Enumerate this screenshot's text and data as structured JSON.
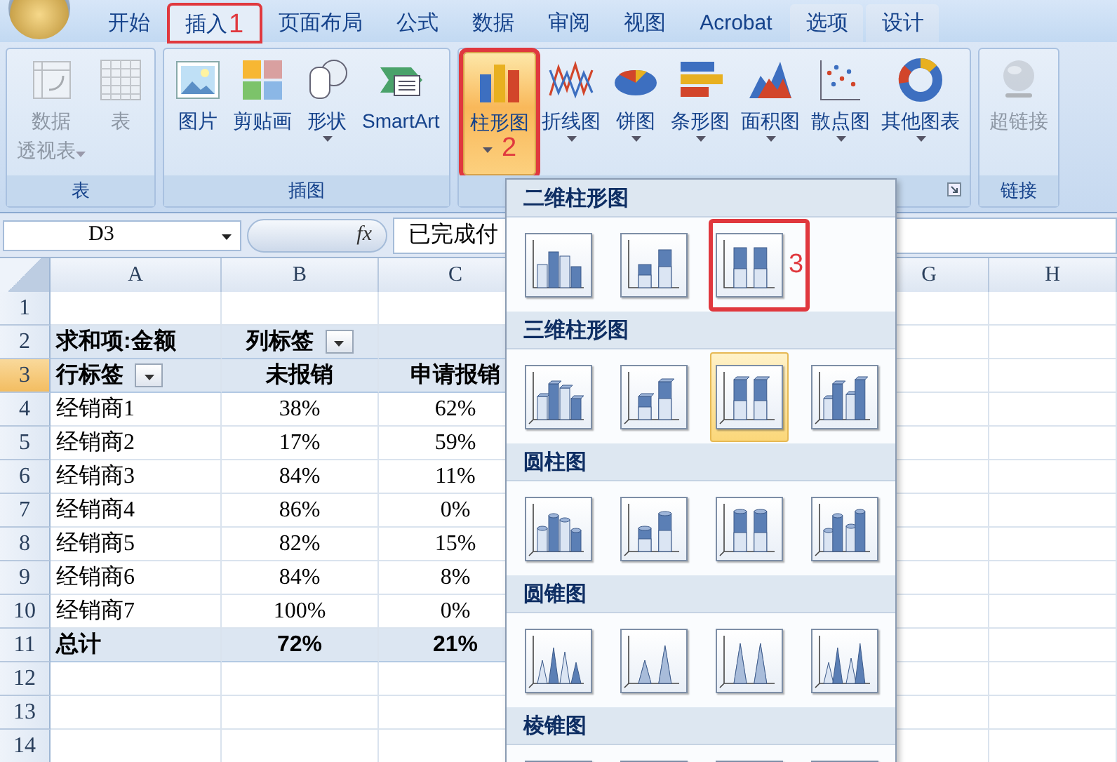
{
  "tabs": [
    {
      "label": "开始",
      "selected": false,
      "contextual": false
    },
    {
      "label": "插入",
      "selected": true,
      "contextual": false,
      "annotation": "1"
    },
    {
      "label": "页面布局",
      "selected": false,
      "contextual": false
    },
    {
      "label": "公式",
      "selected": false,
      "contextual": false
    },
    {
      "label": "数据",
      "selected": false,
      "contextual": false
    },
    {
      "label": "审阅",
      "selected": false,
      "contextual": false
    },
    {
      "label": "视图",
      "selected": false,
      "contextual": false
    },
    {
      "label": "Acrobat",
      "selected": false,
      "contextual": false
    },
    {
      "label": "选项",
      "selected": false,
      "contextual": true
    },
    {
      "label": "设计",
      "selected": false,
      "contextual": true
    }
  ],
  "ribbon_groups": [
    {
      "label": "表",
      "buttons": [
        {
          "lines": [
            "数据",
            "透视表"
          ],
          "disabled": true,
          "dropdown": true,
          "selected": false
        },
        {
          "lines": [
            "表"
          ],
          "disabled": true,
          "dropdown": false,
          "selected": false
        }
      ]
    },
    {
      "label": "插图",
      "buttons": [
        {
          "lines": [
            "图片"
          ],
          "disabled": false,
          "dropdown": false,
          "selected": false
        },
        {
          "lines": [
            "剪贴画"
          ],
          "disabled": false,
          "dropdown": false,
          "selected": false
        },
        {
          "lines": [
            "形状"
          ],
          "disabled": false,
          "dropdown": true,
          "selected": false
        },
        {
          "lines": [
            "SmartArt"
          ],
          "disabled": false,
          "dropdown": false,
          "selected": false
        }
      ]
    },
    {
      "launcher": true,
      "buttons": [
        {
          "lines": [
            "柱形图"
          ],
          "disabled": false,
          "dropdown": true,
          "selected": true,
          "annotation": "2"
        },
        {
          "lines": [
            "折线图"
          ],
          "disabled": false,
          "dropdown": true,
          "selected": false
        },
        {
          "lines": [
            "饼图"
          ],
          "disabled": false,
          "dropdown": true,
          "selected": false
        },
        {
          "lines": [
            "条形图"
          ],
          "disabled": false,
          "dropdown": true,
          "selected": false
        },
        {
          "lines": [
            "面积图"
          ],
          "disabled": false,
          "dropdown": true,
          "selected": false
        },
        {
          "lines": [
            "散点图"
          ],
          "disabled": false,
          "dropdown": true,
          "selected": false
        },
        {
          "lines": [
            "其他图表"
          ],
          "disabled": false,
          "dropdown": true,
          "selected": false
        }
      ]
    },
    {
      "label": "链接",
      "buttons": [
        {
          "lines": [
            "超链接"
          ],
          "disabled": true,
          "dropdown": false,
          "selected": false
        }
      ]
    }
  ],
  "formula_bar": {
    "name_box": "D3",
    "fx": "fx",
    "value": "已完成付"
  },
  "columns": [
    "A",
    "B",
    "C",
    "G",
    "H"
  ],
  "rows": [
    {
      "number": "1",
      "kind": "blank",
      "selected": false,
      "cells": []
    },
    {
      "number": "2",
      "kind": "pivot-head",
      "selected": false,
      "cells": [
        {
          "text": "求和项:金额",
          "filter": false
        },
        {
          "text": "列标签",
          "filter": true
        }
      ]
    },
    {
      "number": "3",
      "kind": "pivot-head",
      "selected": true,
      "cells": [
        {
          "text": "行标签",
          "filter": true
        },
        {
          "text": "未报销",
          "filter": false
        },
        {
          "text": "申请报销",
          "filter": false
        }
      ]
    },
    {
      "number": "4",
      "kind": "data",
      "selected": false,
      "cells": [
        {
          "text": "经销商1"
        },
        {
          "text": "38%"
        },
        {
          "text": "62%"
        }
      ]
    },
    {
      "number": "5",
      "kind": "data",
      "selected": false,
      "cells": [
        {
          "text": "经销商2"
        },
        {
          "text": "17%"
        },
        {
          "text": "59%"
        }
      ]
    },
    {
      "number": "6",
      "kind": "data",
      "selected": false,
      "cells": [
        {
          "text": "经销商3"
        },
        {
          "text": "84%"
        },
        {
          "text": "11%"
        }
      ]
    },
    {
      "number": "7",
      "kind": "data",
      "selected": false,
      "cells": [
        {
          "text": "经销商4"
        },
        {
          "text": "86%"
        },
        {
          "text": "0%"
        }
      ]
    },
    {
      "number": "8",
      "kind": "data",
      "selected": false,
      "cells": [
        {
          "text": "经销商5"
        },
        {
          "text": "82%"
        },
        {
          "text": "15%"
        }
      ]
    },
    {
      "number": "9",
      "kind": "data",
      "selected": false,
      "cells": [
        {
          "text": "经销商6"
        },
        {
          "text": "84%"
        },
        {
          "text": "8%"
        }
      ]
    },
    {
      "number": "10",
      "kind": "data",
      "selected": false,
      "cells": [
        {
          "text": "经销商7"
        },
        {
          "text": "100%"
        },
        {
          "text": "0%"
        }
      ]
    },
    {
      "number": "11",
      "kind": "total",
      "selected": false,
      "cells": [
        {
          "text": "总计"
        },
        {
          "text": "72%"
        },
        {
          "text": "21%"
        }
      ]
    },
    {
      "number": "12",
      "kind": "blank",
      "selected": false,
      "cells": []
    },
    {
      "number": "13",
      "kind": "blank",
      "selected": false,
      "cells": []
    },
    {
      "number": "14",
      "kind": "blank",
      "selected": false,
      "cells": []
    }
  ],
  "gallery": [
    {
      "title": "二维柱形图",
      "items": [
        {
          "selected": false
        },
        {
          "selected": false
        },
        {
          "selected": false,
          "annotation": "3"
        }
      ]
    },
    {
      "title": "三维柱形图",
      "items": [
        {
          "selected": false
        },
        {
          "selected": false
        },
        {
          "selected": true
        },
        {
          "selected": false
        }
      ]
    },
    {
      "title": "圆柱图",
      "items": [
        {
          "selected": false
        },
        {
          "selected": false
        },
        {
          "selected": false
        },
        {
          "selected": false
        }
      ]
    },
    {
      "title": "圆锥图",
      "items": [
        {
          "selected": false
        },
        {
          "selected": false
        },
        {
          "selected": false
        },
        {
          "selected": false
        }
      ]
    },
    {
      "title": "棱锥图",
      "items": [
        {
          "selected": false
        },
        {
          "selected": false
        },
        {
          "selected": false
        },
        {
          "selected": false
        }
      ]
    }
  ]
}
